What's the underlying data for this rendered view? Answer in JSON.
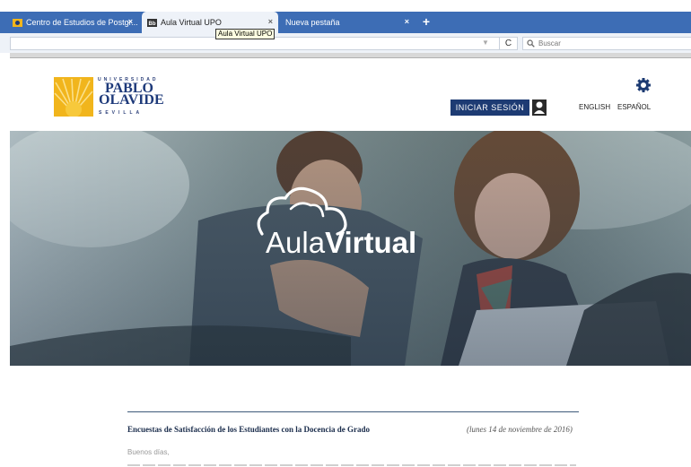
{
  "browser": {
    "tabs": [
      {
        "label": "Centro de Estudios de Postgr...",
        "icon": "upo-favicon",
        "active": false
      },
      {
        "label": "Aula Virtual UPO",
        "icon": "bb-favicon",
        "active": true
      },
      {
        "label": "Nueva pestaña",
        "icon": "",
        "active": false
      }
    ],
    "close_glyph": "×",
    "new_tab_glyph": "+",
    "tooltip": "Aula Virtual UPO",
    "search_placeholder": "Buscar",
    "reload_glyph": "C",
    "dropmarker_glyph": "▼"
  },
  "site": {
    "logo": {
      "top": "UNIVERSIDAD",
      "name_line1": "PABLO",
      "name_line2": "OLAVIDE",
      "bottom": "SEVILLA",
      "color": "#1e3a7a",
      "sun_color": "#f1b51c"
    },
    "login_label": "INICIAR SESIÓN",
    "languages": [
      "ENGLISH",
      "ESPAÑOL"
    ],
    "settings_icon": "gear-icon",
    "accent": "#1d3b73"
  },
  "hero": {
    "brand_light": "Aula",
    "brand_bold": "Virtual",
    "icon": "cloud-icon"
  },
  "content": {
    "article_title": "Encuestas de Satisfacción de los Estudiantes con la Docencia de Grado",
    "article_date": "(lunes 14 de noviembre de 2016)",
    "greeting": "Buenos días,"
  }
}
